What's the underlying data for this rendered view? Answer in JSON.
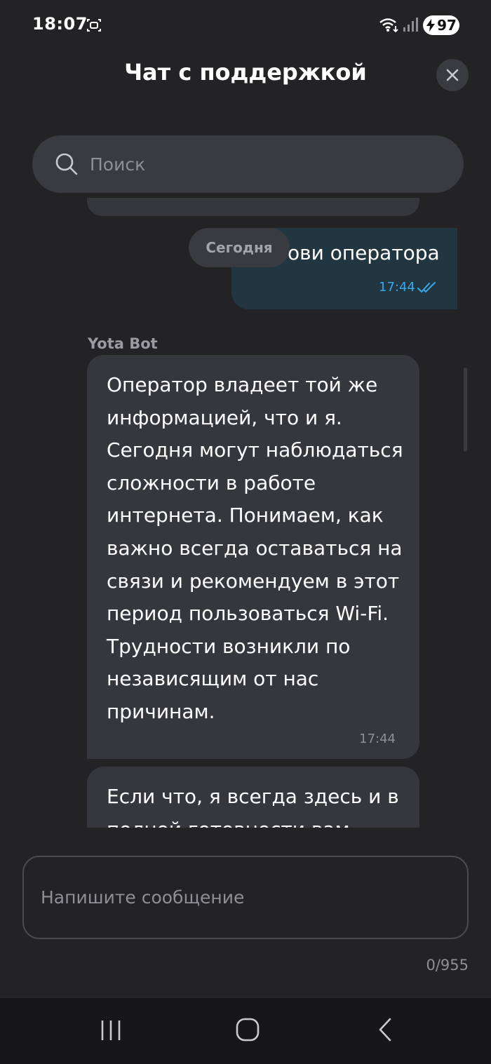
{
  "status_bar": {
    "time": "18:07",
    "battery": "97",
    "icons": [
      "screen-record-icon",
      "wifi-icon",
      "signal-icon",
      "charging-icon"
    ]
  },
  "header": {
    "title": "Чат с поддержкой",
    "close_icon": "close-icon"
  },
  "search": {
    "placeholder": "Поиск",
    "icon": "search-icon"
  },
  "chat": {
    "date_chip": "Сегодня",
    "user_message": {
      "text": "ови оператора",
      "time": "17:44",
      "status_icon": "double-check-icon"
    },
    "bot_name": "Yota Bot",
    "bot_messages": [
      {
        "text": "Оператор владеет той же информацией, что и я. Сегодня могут наблюдаться сложности в работе интернета. Понимаем, как важно всегда оставаться на связи и рекомендуем в этот период пользоваться Wi-Fi. Трудности возникли по независящим от нас причинам.",
        "time": "17:44"
      },
      {
        "text": "Если что, я всегда здесь и в полной готовности вам"
      }
    ]
  },
  "composer": {
    "placeholder": "Напишите сообщение",
    "counter": "0/955"
  },
  "nav_bar": {
    "icons": [
      "recents-icon",
      "home-icon",
      "back-icon"
    ]
  },
  "colors": {
    "background": "#232326",
    "bubble_bot": "#36373d",
    "bubble_user": "#223642",
    "accent": "#3aa8e8"
  }
}
